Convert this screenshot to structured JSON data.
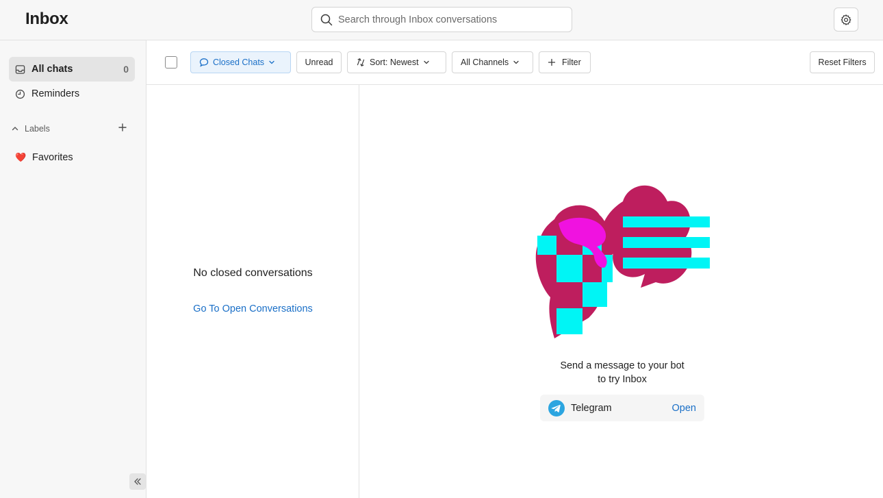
{
  "header": {
    "title": "Inbox",
    "search_placeholder": "Search through Inbox conversations",
    "settings_icon": "gear-icon"
  },
  "sidebar": {
    "items": [
      {
        "label": "All chats",
        "count": "0",
        "icon": "inbox-icon",
        "active": true
      },
      {
        "label": "Reminders",
        "icon": "clock-icon"
      }
    ],
    "labels_heading": "Labels",
    "labels": [
      {
        "label": "Favorites",
        "emoji": "❤️"
      }
    ]
  },
  "toolbar": {
    "closed_chats": "Closed Chats",
    "unread": "Unread",
    "sort": "Sort: Newest",
    "all_channels": "All Channels",
    "filter": "Filter",
    "reset_filters": "Reset Filters"
  },
  "list": {
    "empty_title": "No closed conversations",
    "open_link": "Go To Open Conversations"
  },
  "detail": {
    "message_line1": "Send a message to your bot",
    "message_line2": "to try Inbox",
    "channel": {
      "name": "Telegram",
      "action": "Open"
    }
  },
  "colors": {
    "accent": "#1a6fc7",
    "magenta": "#be1e5e",
    "cyan": "#00f5f5",
    "pink": "#f012e0",
    "telegram": "#2ca5e0"
  }
}
